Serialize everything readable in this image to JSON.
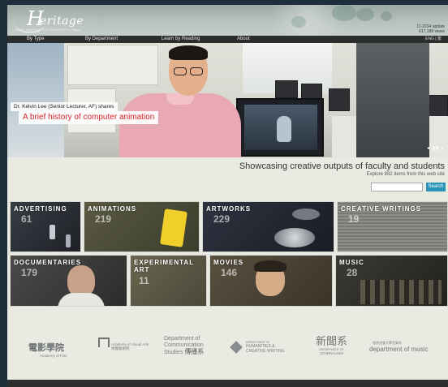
{
  "header": {
    "logo_mark": "H",
    "logo_word": "eritage",
    "logo_sub": "HONG KONG BAPTIST UNIVERSITY Library",
    "update_line1": "11-2014 update",
    "update_line2": "617,188 views"
  },
  "nav": {
    "items": [
      "By Type",
      "By Department",
      "Learn by Reading",
      "About"
    ],
    "lang": "ENG",
    "lang_sep": "|",
    "lang_alt": "繁"
  },
  "hero": {
    "caption_small": "Dr. Kelvin Lee (Senior Lecturer, AF) shares",
    "caption_big": "A brief history of computer animation",
    "controls": "◂ ▮▮ ▸"
  },
  "showcase": {
    "title": "Showcasing creative outputs of faculty and students",
    "subtitle": "Explore 892 items from this web site",
    "search_placeholder": "",
    "search_button": "Search"
  },
  "categories": [
    {
      "name": "ADVERTISING",
      "count": "61"
    },
    {
      "name": "ANIMATIONS",
      "count": "219"
    },
    {
      "name": "ARTWORKS",
      "count": "229"
    },
    {
      "name": "CREATIVE WRITINGS",
      "count": "19"
    },
    {
      "name": "DOCUMENTARIES",
      "count": "179"
    },
    {
      "name": "EXPERIMENTAL ART",
      "count": "11"
    },
    {
      "name": "MOVIES",
      "count": "146"
    },
    {
      "name": "MUSIC",
      "count": "28"
    }
  ],
  "departments": {
    "film": "電影學院",
    "film_en": "Academy of Film",
    "visual_en": "Academy of Visual Arts",
    "visual_zh": "視覺藝術院",
    "comm_line1": "Department of",
    "comm_line2": "Communication",
    "comm_line3": "Studies",
    "comm_zh": "傳播系",
    "humanities_line1": "DEPARTMENT OF",
    "humanities_line2": "HUMANITIES &",
    "humanities_line3": "CREATIVE WRITING",
    "journalism_zh": "新聞系",
    "journalism_en1": "DEPARTMENT OF",
    "journalism_en2": "JOURNALISM",
    "music_zh": "香港浸會大學音樂系",
    "music_en": "department of music"
  },
  "colors": {
    "accent": "#2a93b8",
    "caption_red": "#d2232a",
    "nav_bg": "#2c2e2e"
  }
}
